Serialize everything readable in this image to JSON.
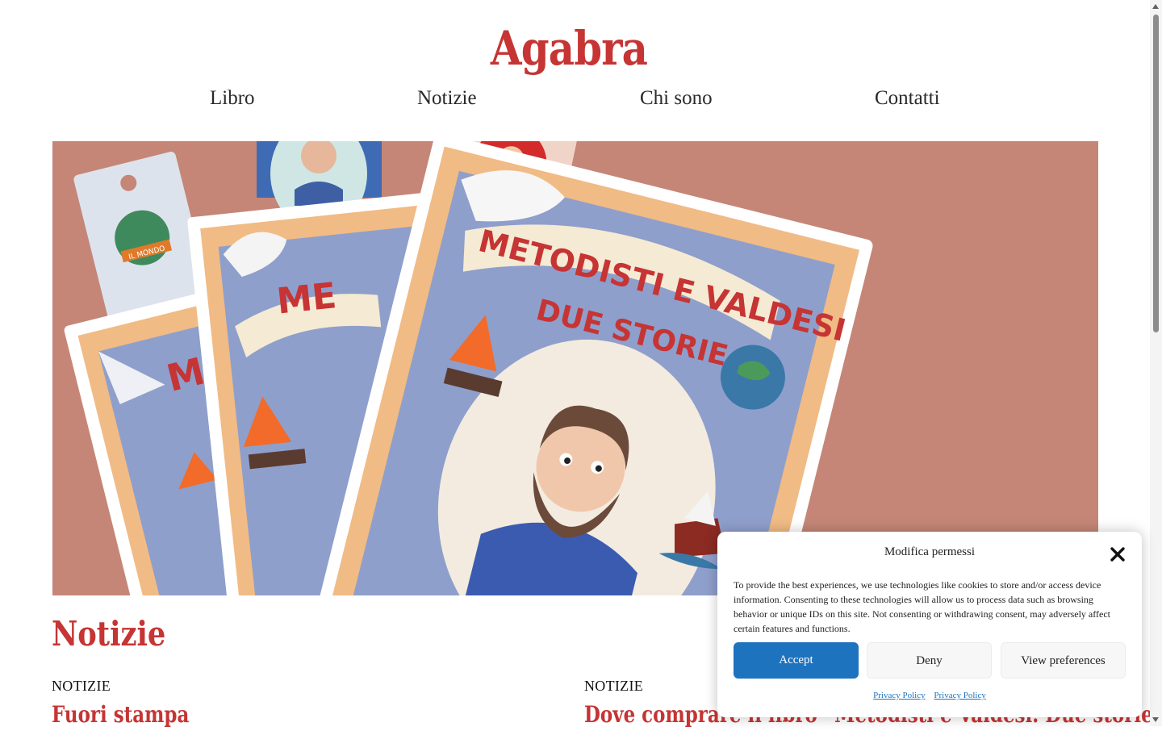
{
  "site": {
    "title": "Agabra"
  },
  "nav": {
    "items": [
      "Libro",
      "Notizie",
      "Chi sono",
      "Contatti"
    ]
  },
  "hero": {
    "book_title_line1": "METODISTI E VALDESI",
    "book_title_line2": "DUE STORIE",
    "book_back_fragment": "ME",
    "book_back_fragment2": "M",
    "bookmark_text": "IL MONDO",
    "background_color": "#c58677"
  },
  "section": {
    "title": "Notizie"
  },
  "posts": [
    {
      "category": "NOTIZIE",
      "title": "Fuori stampa"
    },
    {
      "category": "NOTIZIE",
      "title": "Dove comprare il libro “Metodisti e Valdesi. Due storie.”"
    }
  ],
  "cookie": {
    "title": "Modifica permessi",
    "text": "To provide the best experiences, we use technologies like cookies to store and/or access device information. Consenting to these technologies will allow us to process data such as browsing behavior or unique IDs on this site. Not consenting or withdrawing consent, may adversely affect certain features and functions.",
    "accept": "Accept",
    "deny": "Deny",
    "preferences": "View preferences",
    "links": [
      "Privacy Policy",
      "Privacy Policy"
    ],
    "accent_color": "#1e73be"
  },
  "colors": {
    "brand": "#c63434",
    "nav_text": "#2a2a2a"
  }
}
